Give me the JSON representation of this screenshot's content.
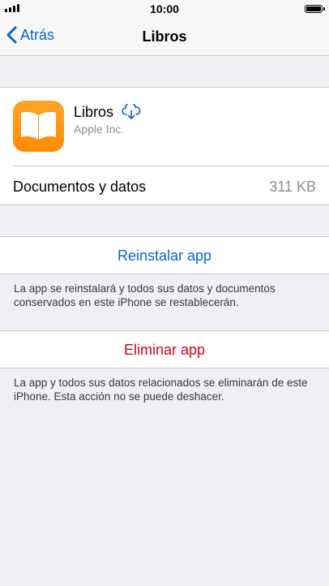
{
  "status_bar": {
    "time": "10:00"
  },
  "nav": {
    "back_label": "Atrás",
    "title": "Libros"
  },
  "app": {
    "name": "Libros",
    "developer": "Apple Inc.",
    "icon": "book-icon",
    "accent_color": "#ff9500"
  },
  "storage": {
    "label": "Documentos y datos",
    "value": "311 KB"
  },
  "reinstall": {
    "label": "Reinstalar app",
    "note": "La app se reinstalará y todos sus datos y documentos conservados en este iPhone se restablecerán."
  },
  "delete": {
    "label": "Eliminar app",
    "note": "La app y todos sus datos relacionados se eliminarán de este iPhone. Esta acción no se puede deshacer."
  },
  "colors": {
    "link": "#0b61d1",
    "destructive": "#d0021b",
    "background": "#efeff4"
  }
}
